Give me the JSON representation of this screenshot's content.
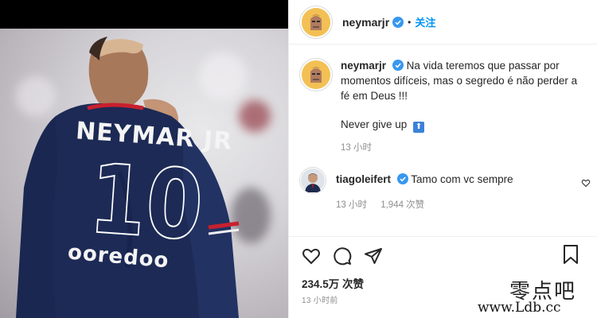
{
  "post": {
    "username": "neymarjr",
    "follow_label": "关注",
    "dot": "•"
  },
  "caption": {
    "username": "neymarjr",
    "text": "Na vida teremos que passar por momentos difíceis, mas o segredo é não perder a fé em Deus !!!",
    "line2": "Never give up",
    "emoji": "⬆",
    "time": "13 小时"
  },
  "comment": {
    "username": "tiagoleifert",
    "text": "Tamo com vc sempre",
    "time": "13 小时",
    "likes": "1,944 次赞"
  },
  "stats": {
    "likes": "234.5万 次赞",
    "time": "13 小时前"
  },
  "photo": {
    "jersey_name": "NEYMAR JR",
    "jersey_number": "10",
    "sponsor": "ooredoo"
  },
  "watermark": {
    "cn": "零点吧",
    "url": "www.Ldb.cc"
  },
  "colors": {
    "follow": "#0095f6",
    "verified": "#3897f0",
    "jersey": "#1c2a55"
  },
  "icons": [
    "verified-icon",
    "heart-icon",
    "comment-icon",
    "share-icon",
    "bookmark-icon"
  ]
}
